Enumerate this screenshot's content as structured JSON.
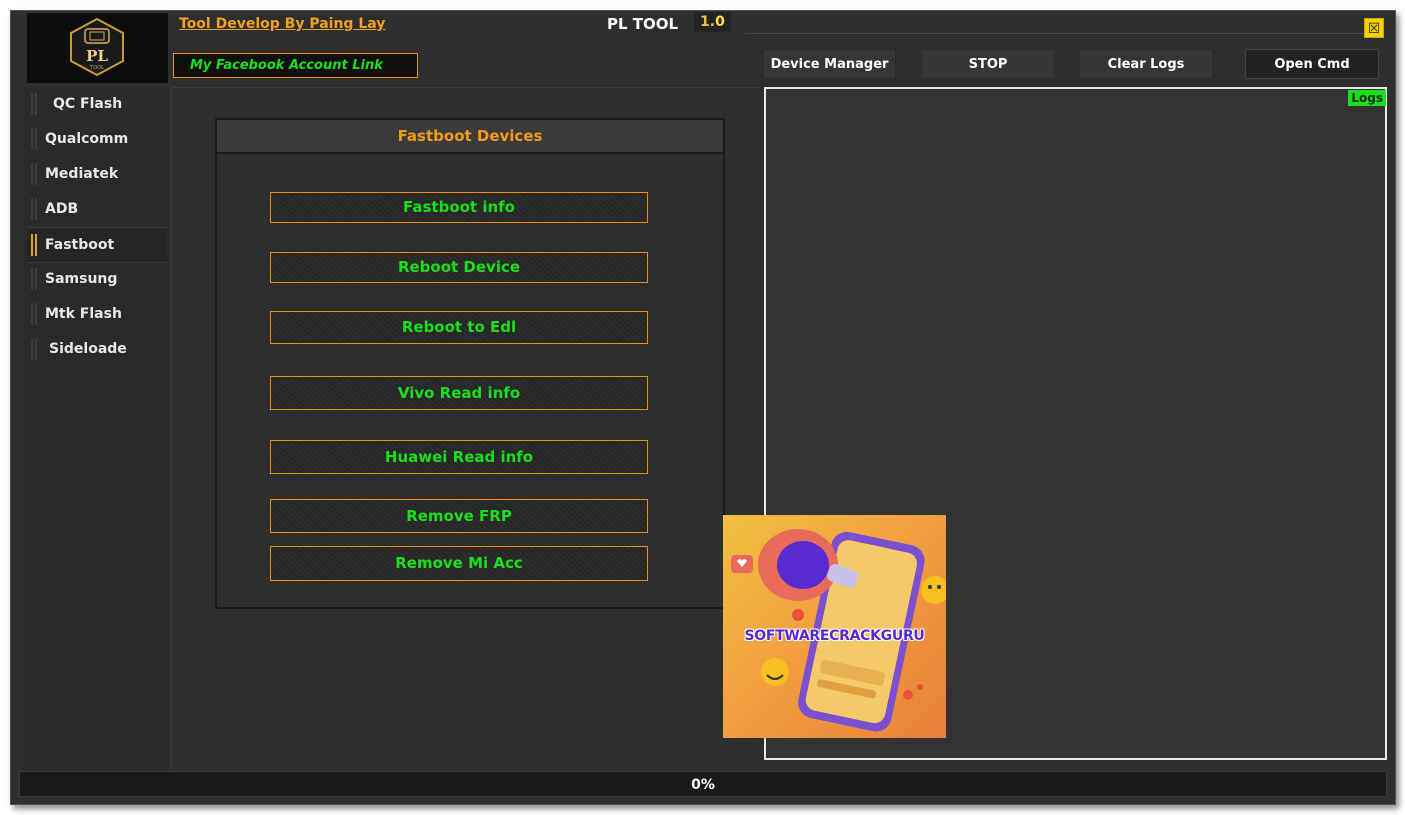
{
  "header": {
    "developer_link": "Tool Develop By Paing Lay",
    "app_name": "PL TOOL",
    "version_major": "1.",
    "version_minor": "0",
    "close_symbol": "☒",
    "logo_text": "PL",
    "logo_subtext": "TOOL"
  },
  "toolbar": {
    "facebook_link": "My Facebook Account Link",
    "device_manager": "Device Manager",
    "stop": "STOP",
    "clear_logs": "Clear Logs",
    "open_cmd": "Open Cmd"
  },
  "sidebar": {
    "items": [
      {
        "label": "QC Flash",
        "active": false
      },
      {
        "label": "Qualcomm",
        "active": false
      },
      {
        "label": "Mediatek",
        "active": false
      },
      {
        "label": "ADB",
        "active": false
      },
      {
        "label": "Fastboot",
        "active": true
      },
      {
        "label": "Samsung",
        "active": false
      },
      {
        "label": "Mtk Flash",
        "active": false
      },
      {
        "label": "Sideloade",
        "active": false
      }
    ]
  },
  "fastboot": {
    "title": "Fastboot Devices",
    "buttons": [
      "Fastboot info",
      "Reboot Device",
      "Reboot to Edl",
      "Vivo Read info",
      "Huawei Read info",
      "Remove FRP",
      "Remove Mi Acc"
    ]
  },
  "logs": {
    "label": "Logs"
  },
  "status": {
    "progress_text": "0%",
    "progress": 0
  },
  "ad_overlay": {
    "text": "SOFTWARECRACKGURU"
  },
  "colors": {
    "accent_orange": "#e8911a",
    "button_text_green": "#19e019",
    "background": "#2e2e2e",
    "close_yellow": "#f2d200"
  },
  "icons": {
    "close": "close-icon",
    "logo": "pl-tool-logo",
    "side_marker": "double-bar-icon"
  }
}
